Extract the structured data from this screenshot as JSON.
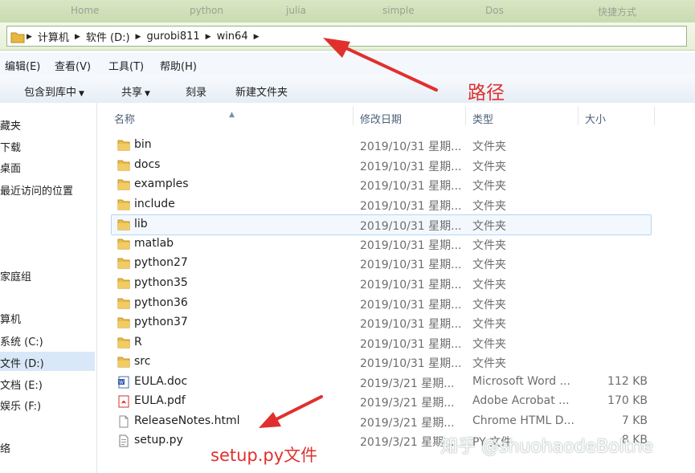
{
  "tabs": [
    "Home",
    "python",
    "julia",
    "simple",
    "Dos",
    "快捷方式"
  ],
  "breadcrumb": [
    "计算机",
    "软件 (D:)",
    "gurobi811",
    "win64"
  ],
  "menubar": [
    "编辑(E)",
    "查看(V)",
    "工具(T)",
    "帮助(H)"
  ],
  "commands": [
    "包含到库中",
    "共享",
    "刻录",
    "新建文件夹"
  ],
  "nav": [
    "藏夹",
    "下载",
    "桌面",
    "最近访问的位置",
    "家庭组",
    "算机",
    "系统 (C:)",
    "文件 (D:)",
    "文档 (E:)",
    "娱乐 (F:)",
    "络"
  ],
  "columns": {
    "name": "名称",
    "date": "修改日期",
    "type": "类型",
    "size": "大小"
  },
  "files": [
    {
      "name": "bin",
      "date": "2019/10/31 星期...",
      "type": "文件夹",
      "size": "",
      "icon": "folder-icon"
    },
    {
      "name": "docs",
      "date": "2019/10/31 星期...",
      "type": "文件夹",
      "size": "",
      "icon": "folder-icon"
    },
    {
      "name": "examples",
      "date": "2019/10/31 星期...",
      "type": "文件夹",
      "size": "",
      "icon": "folder-icon"
    },
    {
      "name": "include",
      "date": "2019/10/31 星期...",
      "type": "文件夹",
      "size": "",
      "icon": "folder-icon"
    },
    {
      "name": "lib",
      "date": "2019/10/31 星期...",
      "type": "文件夹",
      "size": "",
      "icon": "folder-icon"
    },
    {
      "name": "matlab",
      "date": "2019/10/31 星期...",
      "type": "文件夹",
      "size": "",
      "icon": "folder-icon"
    },
    {
      "name": "python27",
      "date": "2019/10/31 星期...",
      "type": "文件夹",
      "size": "",
      "icon": "folder-icon"
    },
    {
      "name": "python35",
      "date": "2019/10/31 星期...",
      "type": "文件夹",
      "size": "",
      "icon": "folder-icon"
    },
    {
      "name": "python36",
      "date": "2019/10/31 星期...",
      "type": "文件夹",
      "size": "",
      "icon": "folder-icon"
    },
    {
      "name": "python37",
      "date": "2019/10/31 星期...",
      "type": "文件夹",
      "size": "",
      "icon": "folder-icon"
    },
    {
      "name": "R",
      "date": "2019/10/31 星期...",
      "type": "文件夹",
      "size": "",
      "icon": "folder-icon"
    },
    {
      "name": "src",
      "date": "2019/10/31 星期...",
      "type": "文件夹",
      "size": "",
      "icon": "folder-icon"
    },
    {
      "name": "EULA.doc",
      "date": "2019/3/21 星期...",
      "type": "Microsoft Word ...",
      "size": "112 KB",
      "icon": "word-doc-icon"
    },
    {
      "name": "EULA.pdf",
      "date": "2019/3/21 星期...",
      "type": "Adobe Acrobat ...",
      "size": "170 KB",
      "icon": "pdf-icon"
    },
    {
      "name": "ReleaseNotes.html",
      "date": "2019/3/21 星期...",
      "type": "Chrome HTML D...",
      "size": "7 KB",
      "icon": "html-file-icon"
    },
    {
      "name": "setup.py",
      "date": "2019/3/21 星期...",
      "type": "PY 文件",
      "size": "8 KB",
      "icon": "python-file-icon"
    }
  ],
  "annotations": {
    "path_label": "路径",
    "setup_label": "setup.py文件",
    "color": "#e0302e"
  },
  "watermark": "知乎 @shuohaodeBoltne"
}
